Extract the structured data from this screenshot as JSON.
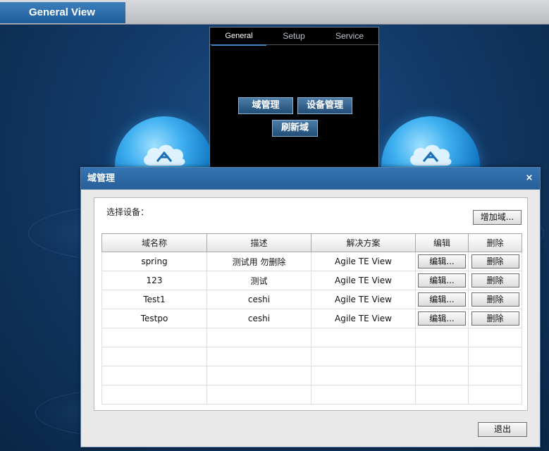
{
  "app": {
    "title": "General View"
  },
  "menu": {
    "tabs": [
      {
        "label": "General",
        "active": true
      },
      {
        "label": "Setup",
        "active": false
      },
      {
        "label": "Service",
        "active": false
      }
    ],
    "buttons": {
      "domain_manage": "域管理",
      "device_manage": "设备管理",
      "refresh_domain": "刷新域"
    }
  },
  "dialog": {
    "title": "域管理",
    "close_glyph": "×",
    "select_device_label": "选择设备：",
    "add_domain_label": "增加域...",
    "exit_label": "退出",
    "table": {
      "columns": [
        "域名称",
        "描述",
        "解决方案",
        "编辑",
        "删除"
      ],
      "rows": [
        {
          "name": "spring",
          "description": "测试用 勿删除",
          "solution": "Agile TE View",
          "edit": "编辑...",
          "delete": "删除"
        },
        {
          "name": "123",
          "description": "测试",
          "solution": "Agile TE View",
          "edit": "编辑...",
          "delete": "删除"
        },
        {
          "name": "Test1",
          "description": "ceshi",
          "solution": "Agile TE View",
          "edit": "编辑...",
          "delete": "删除"
        },
        {
          "name": "Testpo",
          "description": "ceshi",
          "solution": "Agile TE View",
          "edit": "编辑...",
          "delete": "删除"
        }
      ],
      "empty_rows": 4
    }
  },
  "colors": {
    "background": "#123a68",
    "titlebar": "#2e6aa8",
    "accent": "#3b86c8"
  },
  "icons": [
    "cloud-logo-icon",
    "close-icon"
  ]
}
